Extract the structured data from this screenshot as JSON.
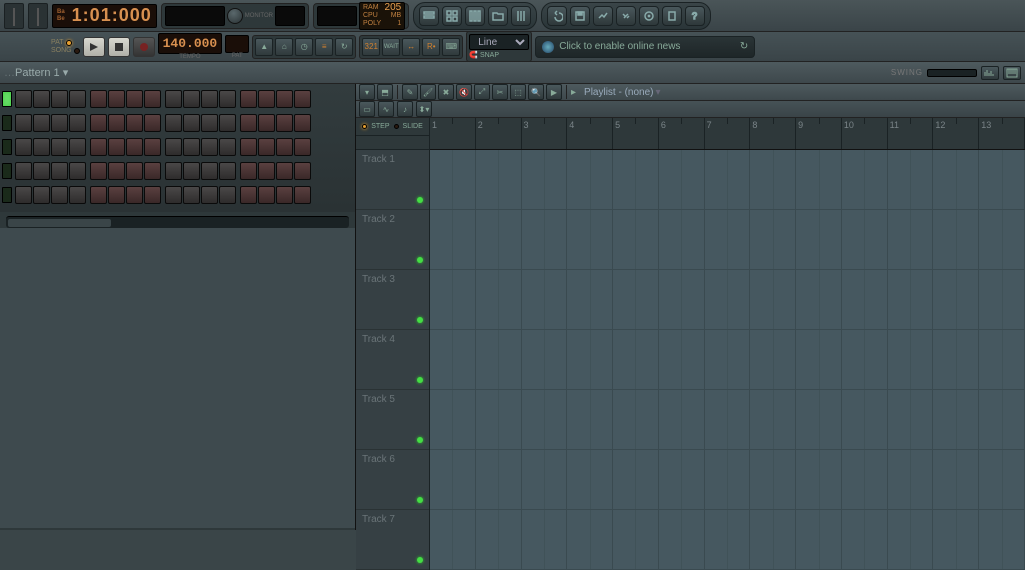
{
  "top": {
    "time_labels": {
      "a": "Ba",
      "b": "Be"
    },
    "time": "1:01:000",
    "monitor_label": "MONITOR",
    "cpu": {
      "value": "205",
      "ram": "RAM",
      "mb": "MB",
      "cpu": "CPU",
      "poly": "POLY",
      "polyval": "1"
    }
  },
  "transport": {
    "pat": "PAT",
    "song": "SONG",
    "tempo": "140.000",
    "tempo_lbl": "TEMPO",
    "pat_lbl": "PAT",
    "snap_mode": "Line",
    "snap_lbl": "SNAP",
    "news": "Click to enable online news"
  },
  "pattern": {
    "name": "Pattern 1",
    "swing": "SWING"
  },
  "playlist": {
    "title": "Playlist - (none)",
    "step": "STEP",
    "slide": "SLIDE",
    "bars": [
      "1",
      "2",
      "3",
      "4",
      "5",
      "6",
      "7",
      "8",
      "9",
      "10",
      "11",
      "12",
      "13"
    ],
    "tracks": [
      "Track 1",
      "Track 2",
      "Track 3",
      "Track 4",
      "Track 5",
      "Track 6",
      "Track 7"
    ]
  },
  "seq": {
    "rows": 5,
    "steps": 16
  }
}
